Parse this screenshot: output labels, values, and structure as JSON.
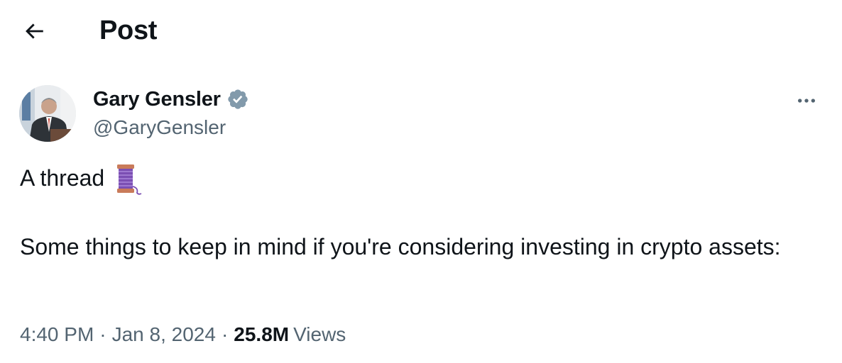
{
  "header": {
    "title": "Post"
  },
  "author": {
    "display_name": "Gary Gensler",
    "handle": "@GaryGensler",
    "verified": true,
    "verified_color": "#829aab"
  },
  "tweet": {
    "first_line": "A thread",
    "emoji": "spool-of-thread",
    "body": "Some things to keep in mind if you're considering investing in crypto assets:"
  },
  "meta": {
    "time": "4:40 PM",
    "separator": "·",
    "date": "Jan 8, 2024",
    "views_count": "25.8M",
    "views_label": "Views"
  },
  "colors": {
    "text_primary": "#0f1419",
    "text_secondary": "#536471",
    "background": "#ffffff"
  }
}
